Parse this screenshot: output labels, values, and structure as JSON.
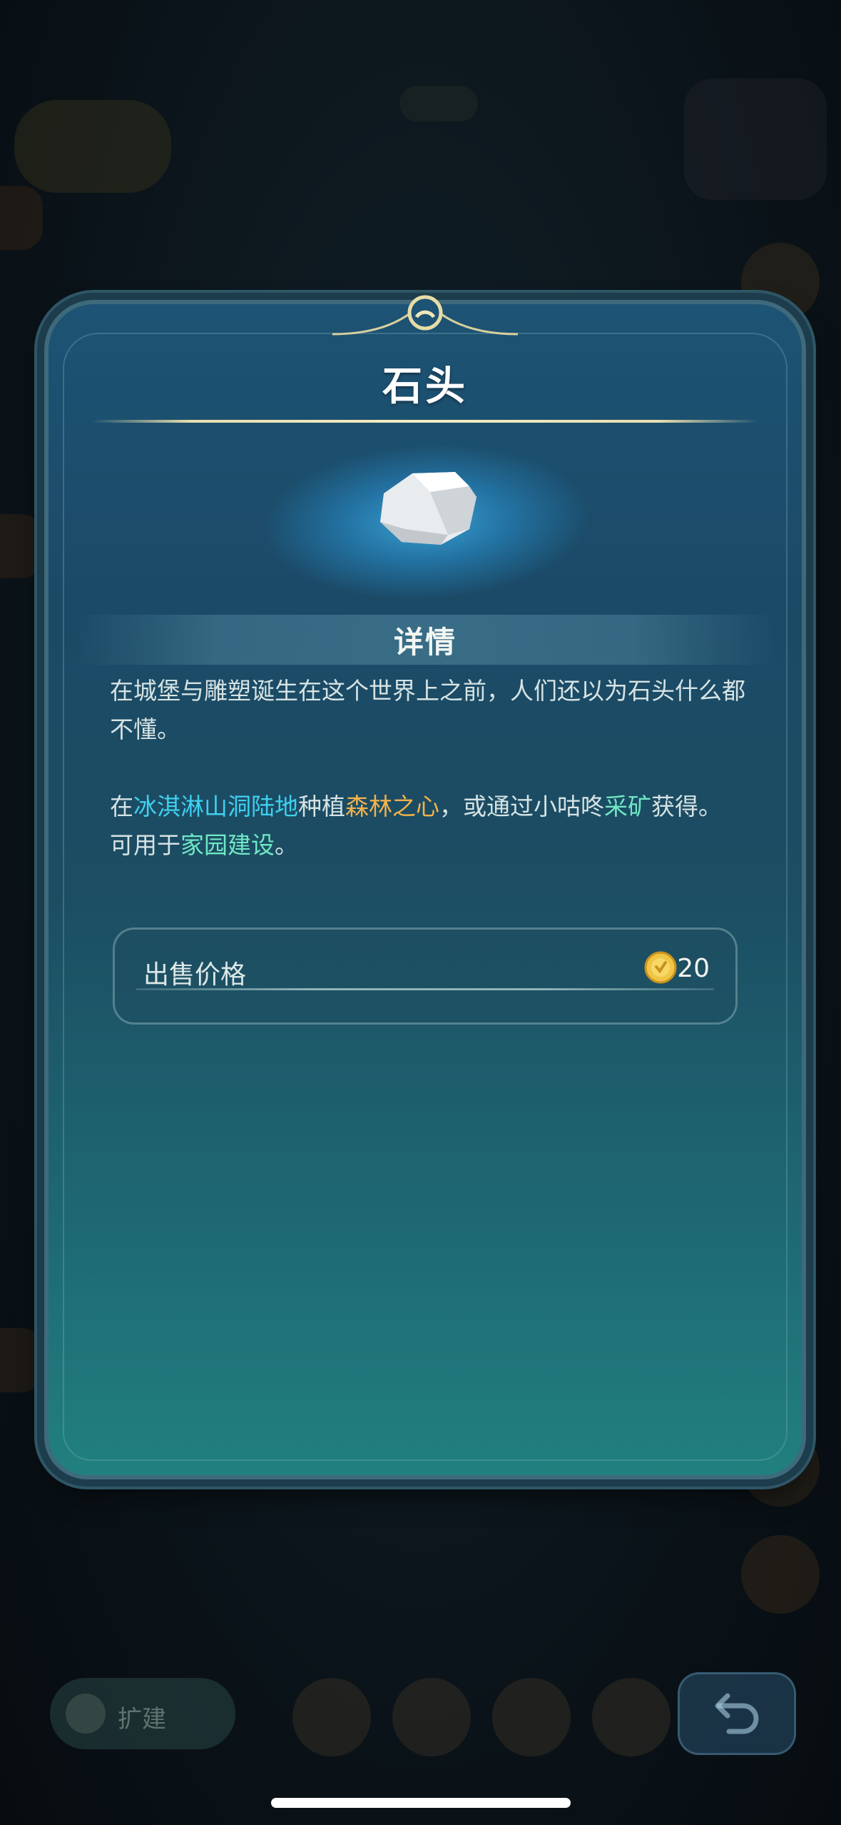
{
  "colors": {
    "accent_blue": "#3fd0f0",
    "accent_orange": "#f3b24a",
    "accent_green": "#6fe8c4",
    "card_top": "#1d5374",
    "card_bottom": "#21807f"
  },
  "item_dialog": {
    "title": "石头",
    "icon": "stone-icon",
    "section_title": "详情",
    "description": {
      "flavor": "在城堡与雕塑诞生在这个世界上之前，人们还以为石头什么都不懂。",
      "source_prefix": "在",
      "source_location": "冰淇淋山洞陆地",
      "source_mid": "种植",
      "source_plant": "森林之心",
      "source_mid2": "，或通过小咕咚",
      "source_action": "采矿",
      "source_suffix": "获得。",
      "usage_prefix": "可用于",
      "usage_target": "家园建设",
      "usage_suffix": "。"
    },
    "sell": {
      "label": "出售价格",
      "currency_icon": "gold-coin-icon",
      "price": "20"
    }
  },
  "background": {
    "expand_button_label": "扩建"
  }
}
